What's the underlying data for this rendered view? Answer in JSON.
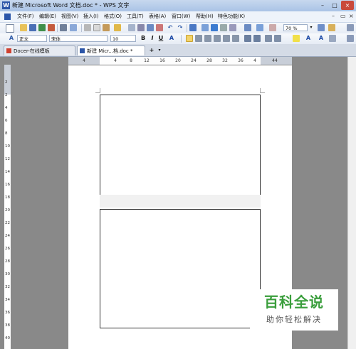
{
  "window": {
    "title": "新建 Microsoft Word 文档.doc * - WPS 文字",
    "app_icon": "W"
  },
  "menu": {
    "items": [
      "文件(F)",
      "编辑(E)",
      "视图(V)",
      "插入(I)",
      "格式(O)",
      "工具(T)",
      "表格(A)",
      "窗口(W)",
      "帮助(H)",
      "特色功能(K)"
    ]
  },
  "toolbar_format": {
    "style_value": "正文",
    "font_value": "宋体",
    "size_value": "10",
    "bold": "B",
    "italic": "I",
    "underline": "U",
    "font_color_glyph": "A"
  },
  "toolbar_standard": {
    "zoom_value": "70 %"
  },
  "tabs": [
    {
      "label": "Docer-在线模板",
      "active": false
    },
    {
      "label": "新建 Micr...档.doc *",
      "active": true
    }
  ],
  "tab_add": "+",
  "ruler": {
    "h_labels": [
      "4",
      "4",
      "8",
      "12",
      "16",
      "20",
      "24",
      "28",
      "32",
      "36",
      "4",
      "44"
    ],
    "v_labels": [
      "2",
      "2",
      "4",
      "6",
      "8",
      "10",
      "12",
      "14",
      "16",
      "18",
      "20",
      "22",
      "24",
      "26",
      "28",
      "30",
      "32",
      "34",
      "36",
      "38",
      "40"
    ]
  },
  "watermark": {
    "title": "百科全说",
    "subtitle": "助你轻松解决"
  },
  "colors": {
    "titlebar": "#b8cde9",
    "page_bg": "#898989",
    "watermark_green": "#3a9e3c"
  }
}
